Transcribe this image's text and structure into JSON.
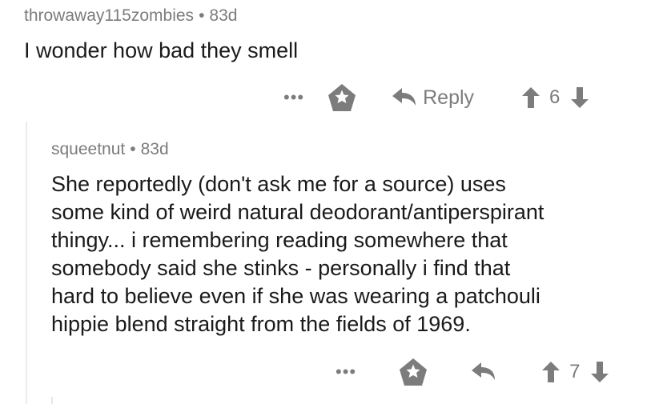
{
  "comment1": {
    "author": "throwaway115zombies",
    "separator": "•",
    "age": "83d",
    "body": "I wonder how bad they smell",
    "actions": {
      "more": "•••",
      "reply_label": "Reply",
      "score": "6"
    }
  },
  "comment2": {
    "author": "squeetnut",
    "separator": "•",
    "age": "83d",
    "body_lines": [
      "She reportedly (don't ask me for a source) uses",
      "some kind of weird natural deodorant/antiperspirant",
      "thingy... i remembering reading somewhere that",
      "somebody said she stinks - personally i find that",
      "hard to believe even if she was wearing a patchouli",
      "hippie blend straight from the fields of 1969."
    ],
    "actions": {
      "more": "•••",
      "score": "7"
    }
  },
  "icons": {
    "more": "more-options-icon",
    "award": "award-icon",
    "reply": "reply-arrow-icon",
    "upvote": "upvote-arrow-icon",
    "downvote": "downvote-arrow-icon"
  },
  "colors": {
    "meta": "#7c7c7c",
    "text": "#1a1a1b",
    "thread_line": "#ececec"
  }
}
